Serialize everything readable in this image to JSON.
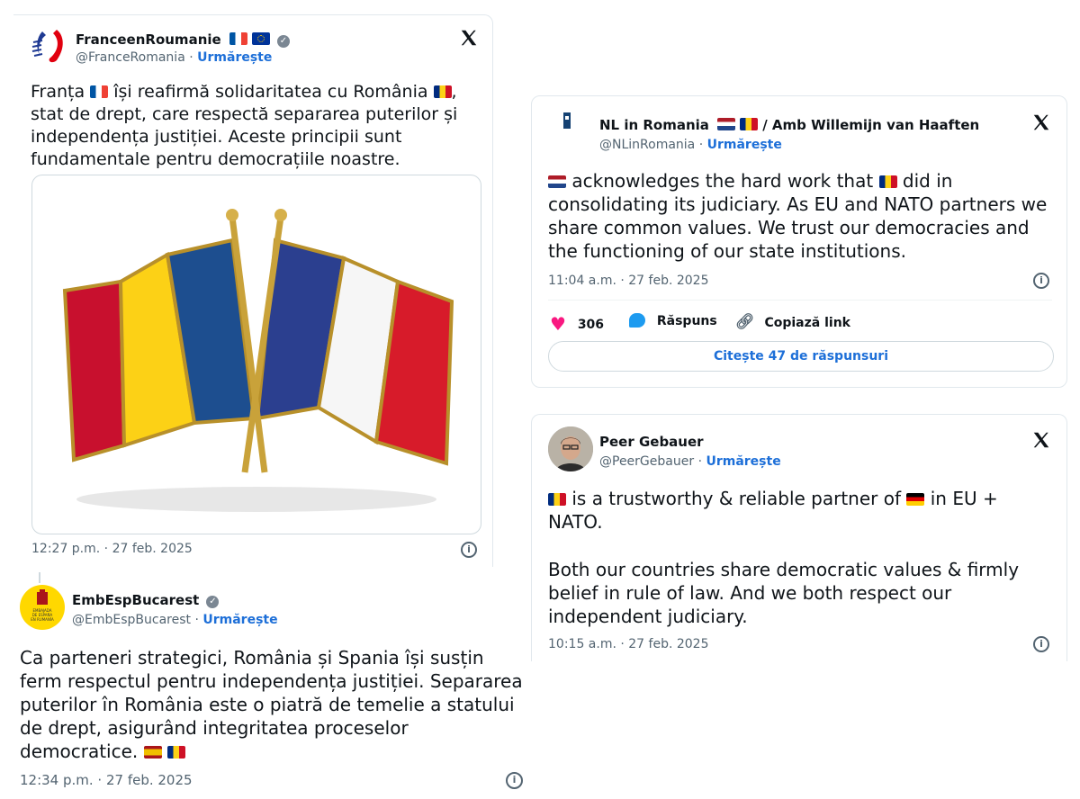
{
  "tweets": {
    "france": {
      "name": "FranceenRoumanie",
      "handle": "@FranceRomania",
      "follow": "Urmărește",
      "text_line1": "Franța",
      "text_line2": "își reafirmă solidaritatea cu România",
      "text_line3": ", stat de",
      "text_rest": "drept, care respectă separarea puterilor și independența justiției. Aceste principii sunt fundamentale pentru democrațiile noastre.",
      "timestamp": "12:27 p.m. · 27 feb. 2025",
      "image_alt": "Crossed Romanian and French flag pin"
    },
    "spain": {
      "name": "EmbEspBucarest",
      "handle": "@EmbEspBucarest",
      "follow": "Urmărește",
      "text": "Ca parteneri strategici, România și Spania își susțin ferm respectul pentru independența justiției. Separarea puterilor în România este o piatră de temelie a statului de drept, asigurând integritatea proceselor democratice.",
      "timestamp": "12:34 p.m. · 27 feb. 2025",
      "avatar_text": "EMBAJADA DE ESPAÑA EN RUMANÍA"
    },
    "netherlands": {
      "name": "NL in Romania",
      "name_suffix": "/ Amb Willemijn van Haaften",
      "handle": "@NLinRomania",
      "follow": "Urmărește",
      "text_a": "acknowledges the hard work that",
      "text_b": "did in consolidating its judiciary. As EU and NATO partners we share common values. We trust our democracies and the functioning of our state institutions.",
      "timestamp": "11:04 a.m. · 27 feb. 2025",
      "likes": "306",
      "reply": "Răspuns",
      "copy": "Copiază link",
      "read_replies": "Citește 47 de răspunsuri"
    },
    "germany": {
      "name": "Peer Gebauer",
      "handle": "@PeerGebauer",
      "follow": "Urmărește",
      "text_a": "is a trustworthy & reliable partner of",
      "text_b": "in EU + NATO.",
      "text_c": "Both our countries share democratic values & firmly belief in rule of law. And we both respect our independent judiciary.",
      "timestamp": "10:15 a.m. · 27 feb. 2025"
    }
  },
  "colors": {
    "link_blue": "#1d6fd8",
    "heart": "#f91880",
    "muted": "#536471"
  }
}
